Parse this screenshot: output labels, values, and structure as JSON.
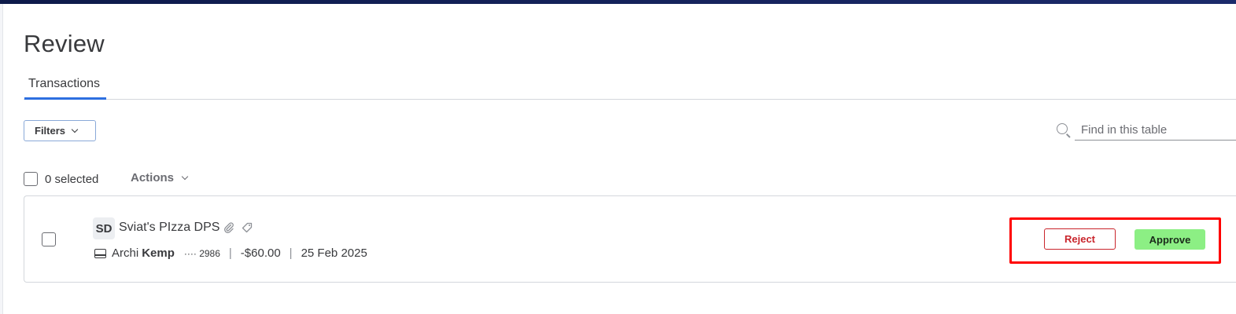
{
  "page": {
    "title": "Review"
  },
  "tabs": [
    {
      "label": "Transactions"
    }
  ],
  "toolbar": {
    "filters_label": "Filters",
    "search_placeholder": "Find in this table"
  },
  "selection": {
    "count_label": "0 selected",
    "actions_label": "Actions"
  },
  "transactions": [
    {
      "initials": "SD",
      "merchant": "Sviat's PIzza DPS",
      "payer_first": "Archi",
      "payer_last": "Kemp",
      "card_last4": "···· 2986",
      "amount": "-$60.00",
      "date": "25 Feb 2025",
      "reject_label": "Reject",
      "approve_label": "Approve"
    }
  ],
  "colors": {
    "accent_tab": "#2d6fe0",
    "reject": "#c9252c",
    "approve": "#8cef84",
    "highlight": "#ff0000"
  }
}
